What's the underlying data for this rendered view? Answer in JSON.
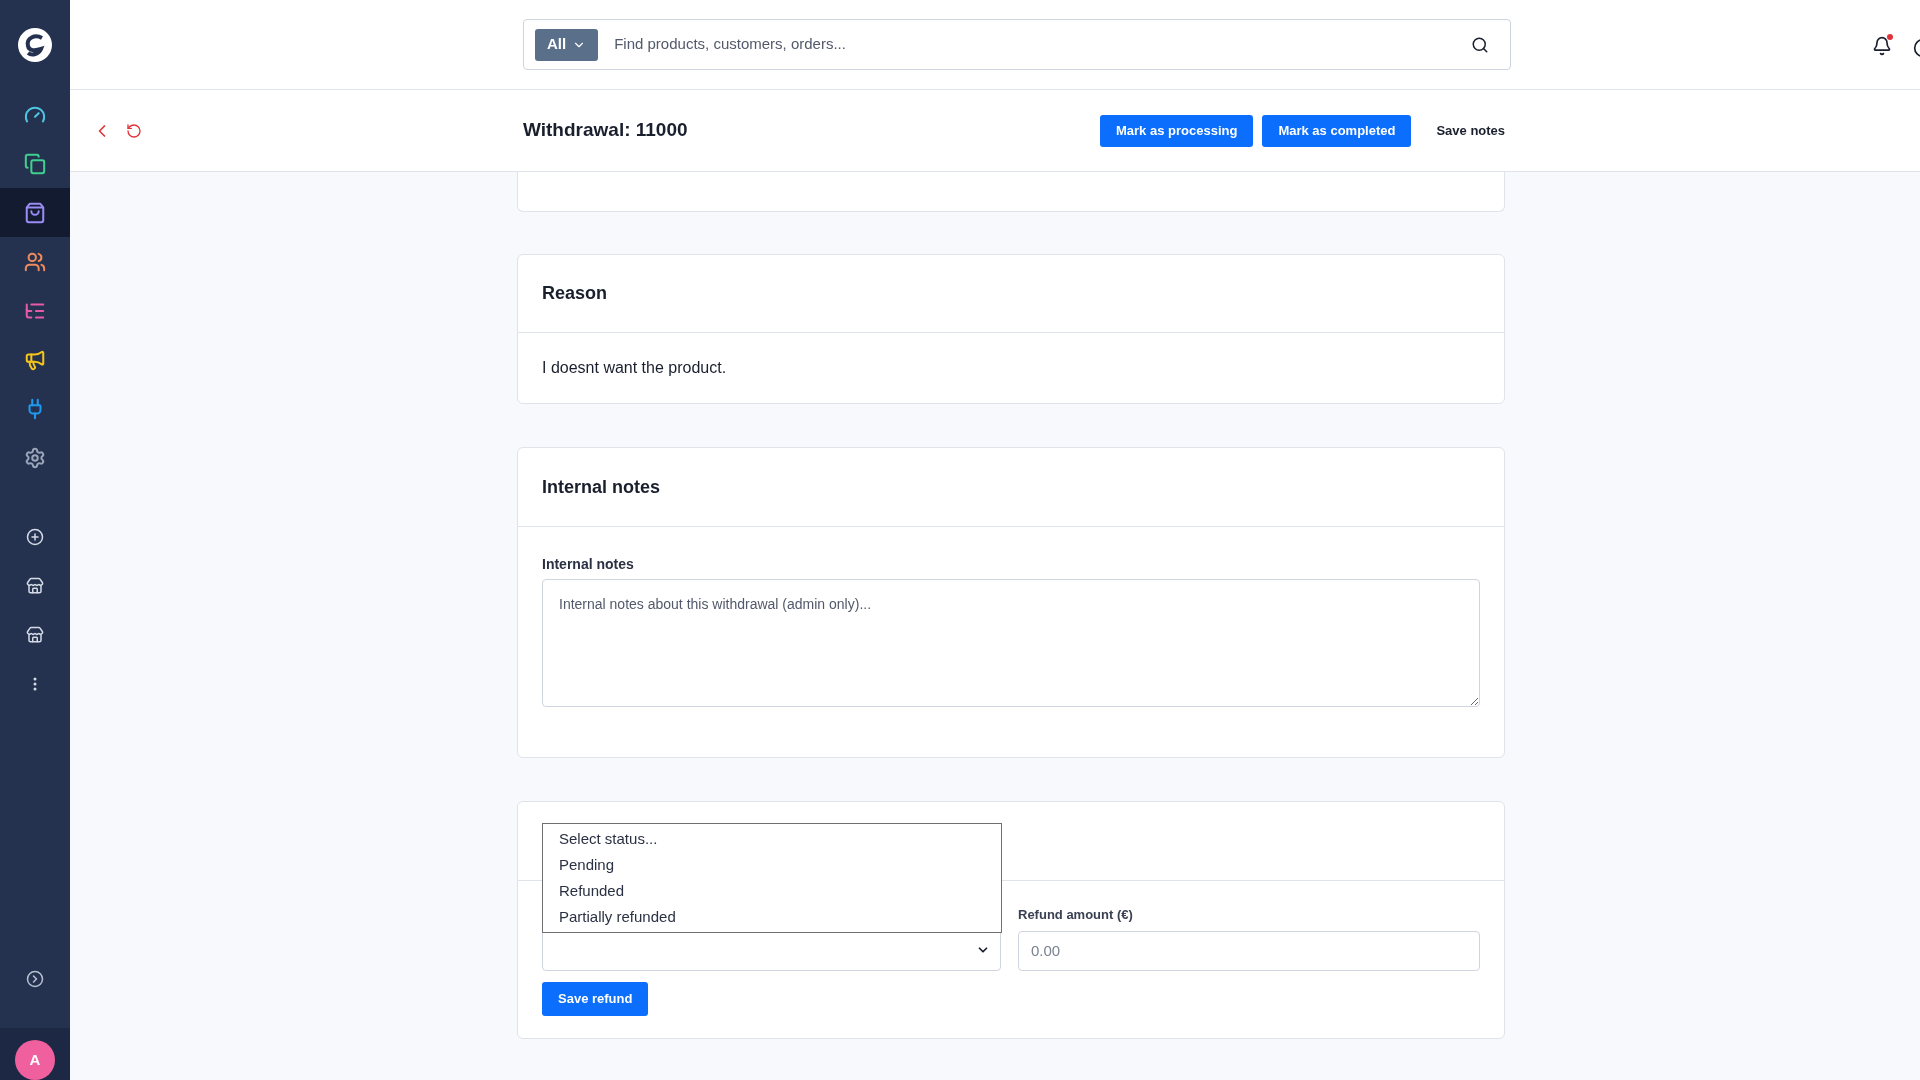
{
  "sidebar": {
    "items": [
      {
        "color": "#4ec5e0",
        "selected": false
      },
      {
        "color": "#3fcf8e",
        "selected": false
      },
      {
        "color": "#9b8cf5",
        "selected": true
      },
      {
        "color": "#f08a5d",
        "selected": false
      },
      {
        "color": "#e85aa8",
        "selected": false
      },
      {
        "color": "#f5c518",
        "selected": false
      },
      {
        "color": "#1e9bf0",
        "selected": false
      },
      {
        "color": "#9aa5b8",
        "selected": false
      }
    ],
    "avatar": "A"
  },
  "search": {
    "scope": "All",
    "placeholder": "Find products, customers, orders..."
  },
  "notifications": {
    "unread": true
  },
  "header": {
    "title": "Withdrawal: 11000",
    "buttons": [
      {
        "label": "Mark as processing",
        "kind": "primary"
      },
      {
        "label": "Mark as completed",
        "kind": "primary"
      },
      {
        "label": "Save notes",
        "kind": "plain"
      }
    ]
  },
  "reason": {
    "title": "Reason",
    "text": "I doesnt want the product."
  },
  "notes": {
    "title": "Internal notes",
    "label": "Internal notes",
    "placeholder": "Internal notes about this withdrawal (admin only)..."
  },
  "refund": {
    "status_options": [
      {
        "label": "Select status...",
        "selected": false
      },
      {
        "label": "Pending",
        "selected": false
      },
      {
        "label": "Refunded",
        "selected": false
      },
      {
        "label": "Partially refunded",
        "selected": false
      }
    ],
    "dropdown_open": true,
    "amount_label": "Refund amount (€)",
    "amount_placeholder": "0.00",
    "save": "Save refund"
  }
}
